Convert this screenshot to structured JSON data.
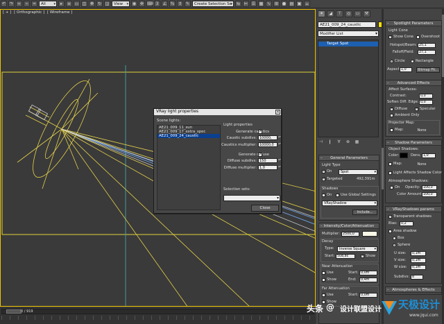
{
  "toolbar": {
    "filter_select": "All",
    "view_select": "View",
    "selection_set": "Create Selection Se"
  },
  "viewport": {
    "label_plus": "[ + ]",
    "label_view": "[ Orthographic ]",
    "label_shading": "[ Wireframe ]"
  },
  "timeline": {
    "frame_counter": "0 / 919"
  },
  "vray_dialog": {
    "title": "VRay light properties",
    "scene_lights_label": "Scene lights:",
    "lights": [
      "AE21_009_11_sun",
      "AE21_009_17_extra_spec",
      "AE21_009_24_caustic"
    ],
    "light_properties_label": "Light properties",
    "generate_caustics_label": "Generate caustics",
    "caustic_subdivs_label": "Caustic subdivs:",
    "caustic_subdivs_value": "10000,",
    "caustics_multiplier_label": "Caustics multiplier:",
    "caustics_multiplier_value": "10000,0",
    "generate_diffuse_label": "Generate diffuse",
    "diffuse_subdivs_label": "Diffuse subdivs:",
    "diffuse_subdivs_value": "150",
    "diffuse_multiplier_label": "Diffuse multiplier:",
    "diffuse_multiplier_value": "1,0",
    "selection_sets_label": "Selection sets:",
    "close_label": "Close"
  },
  "command_panel": {
    "object_name": "AE21_009_24_caustic",
    "object_color": "#f5e000",
    "modifier_list": "Modifier List",
    "stack_item": "Target Spot"
  },
  "general_parameters": {
    "title": "General Parameters",
    "light_type_label": "Light Type",
    "on_label": "On",
    "type_value": "Spot",
    "targeted_label": "Targeted",
    "targeted_distance": "492,391m",
    "shadows_label": "Shadows",
    "shadows_on_label": "On",
    "use_global_label": "Use Global Settings",
    "shadow_type": "VRayShadow",
    "include_label": "Include..."
  },
  "intensity": {
    "title": "Intensity/Color/Attenuation",
    "multiplier_label": "Multiplier:",
    "multiplier_value": "2500,0",
    "light_color": "#fbf7e6",
    "decay_label": "Decay",
    "type_label": "Type:",
    "decay_type": "Inverse Square",
    "start_label": "Start:",
    "start_value": "508,8c",
    "show_label": "Show",
    "near_atten_label": "Near Attenuation",
    "use_label": "Use",
    "near_start_label": "Start:",
    "near_start_value": "0,0m",
    "near_show_label": "Show",
    "near_end_label": "End:",
    "near_end_value": "0,4m",
    "far_atten_label": "Far Attenuation",
    "far_use_label": "Use",
    "far_start_label": "Start:",
    "far_start_value": "0,0m",
    "far_show_label": "Show"
  },
  "spotlight_parameters": {
    "title": "Spotlight Parameters",
    "light_cone_label": "Light Cone",
    "show_cone_label": "Show Cone",
    "overshoot_label": "Overshoot",
    "hotspot_label": "Hotspot/Beam:",
    "hotspot_value": "25,1",
    "falloff_label": "Falloff/Field:",
    "falloff_value": "27,1",
    "circle_label": "Circle",
    "rectangle_label": "Rectangle",
    "aspect_label": "Aspect:",
    "aspect_value": "1,0",
    "bitmap_fit_label": "Bitmap Fit..."
  },
  "advanced_effects": {
    "title": "Advanced Effects",
    "affect_surfaces_label": "Affect Surfaces:",
    "contrast_label": "Contrast:",
    "contrast_value": "0,0",
    "soften_label": "Soften Diff. Edge:",
    "soften_value": "0,0",
    "diffuse_label": "Diffuse",
    "specular_label": "Specular",
    "ambient_only_label": "Ambient Only",
    "projector_map_label": "Projector Map:",
    "map_label": "Map:",
    "map_none": "None"
  },
  "shadow_parameters": {
    "title": "Shadow Parameters",
    "object_shadows_label": "Object Shadows:",
    "color_label": "Color:",
    "dens_label": "Dens.",
    "dens_value": "1,0",
    "map_label": "Map:",
    "map_none": "None",
    "light_affects_label": "Light Affects Shadow Color",
    "atmosphere_shadows_label": "Atmosphere Shadows:",
    "on_label": "On",
    "opacity_label": "Opacity:",
    "opacity_value": "100,0",
    "color_amount_label": "Color Amount:",
    "color_amount_value": "100,0"
  },
  "vrayshadows": {
    "title": "VRayShadows params",
    "transparent_label": "Transparent shadows",
    "bias_label": "Bias:",
    "bias_value": "0,2",
    "area_shadow_label": "Area shadow",
    "box_label": "Box",
    "sphere_label": "Sphere",
    "u_size_label": "U size:",
    "u_size_value": "0,1m",
    "v_size_label": "V size:",
    "v_size_value": "0,1m",
    "w_size_label": "W size:",
    "w_size_value": "0,1m",
    "subdivs_label": "Subdivs:",
    "subdivs_value": "8"
  },
  "atmospheres": {
    "title": "Atmospheres & Effects"
  },
  "watermark": {
    "prefix": "头条",
    "at": "@",
    "author": "设计联盟设计",
    "logo_text": "天极设计",
    "site": "www.jqui.com"
  }
}
